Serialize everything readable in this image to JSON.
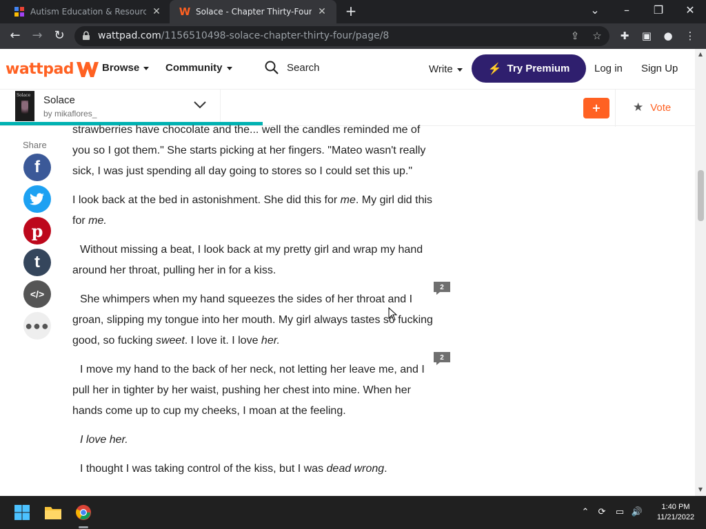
{
  "browser": {
    "tabs": [
      {
        "title": "Autism Education & Resources | A",
        "active": false,
        "favicon_icon": "puzzle-icon"
      },
      {
        "title": "Solace - Chapter Thirty-Four* - P",
        "active": true,
        "favicon_icon": "wattpad-w-icon"
      }
    ],
    "url_host": "wattpad.com",
    "url_path": "/1156510498-solace-chapter-thirty-four/page/8"
  },
  "nav": {
    "logo": "wattpad",
    "browse": "Browse",
    "community": "Community",
    "search": "Search",
    "write": "Write",
    "premium": "Try Premium",
    "login": "Log in",
    "signup": "Sign Up"
  },
  "story": {
    "title": "Solace",
    "author": "by mikaflores_",
    "cover_text": "Solace",
    "vote": "Vote",
    "add": "+",
    "reading_progress": 0.378
  },
  "share": {
    "label": "Share"
  },
  "paragraphs": {
    "p1": "strawberries have chocolate and the... well the candles reminded me of you so I got them.\" She starts picking at her fingers. \"Mateo wasn't really sick, I was just spending all day going to stores so I could set this up.\"",
    "p2a": "I look back at the bed in astonishment. She did this for ",
    "p2b": "me",
    "p2c": ". My girl did this for ",
    "p2d": "me.",
    "p3": "Without missing a beat, I look back at my pretty girl and wrap my hand around her throat, pulling her in for a kiss.",
    "p4a": "She whimpers when my hand squeezes the sides of her throat and I groan, slipping my tongue into her mouth. My girl always tastes so fucking good, so fucking ",
    "p4b": "sweet",
    "p4c": ". I love it. I love ",
    "p4d": "her.",
    "p5": "I move my hand to the back of her neck, not letting her leave me, and I pull her in tighter by her waist, pushing her chest into mine. When her hands come up to cup my cheeks, I moan at the feeling.",
    "p6": "I love her.",
    "p7a": "I thought I was taking control of the kiss, but I was ",
    "p7b": "dead wrong",
    "p7c": "."
  },
  "comments": {
    "c1": "2",
    "c2": "2"
  },
  "taskbar": {
    "time": "1:40 PM",
    "date": "11/21/2022"
  },
  "colors": {
    "brand": "#ff6122",
    "premium": "#2f1f6e",
    "progress": "#00b2b2",
    "facebook": "#3b5998",
    "twitter": "#1da1f2",
    "pinterest": "#bd081c",
    "tumblr": "#35465c",
    "embed": "#555555"
  }
}
